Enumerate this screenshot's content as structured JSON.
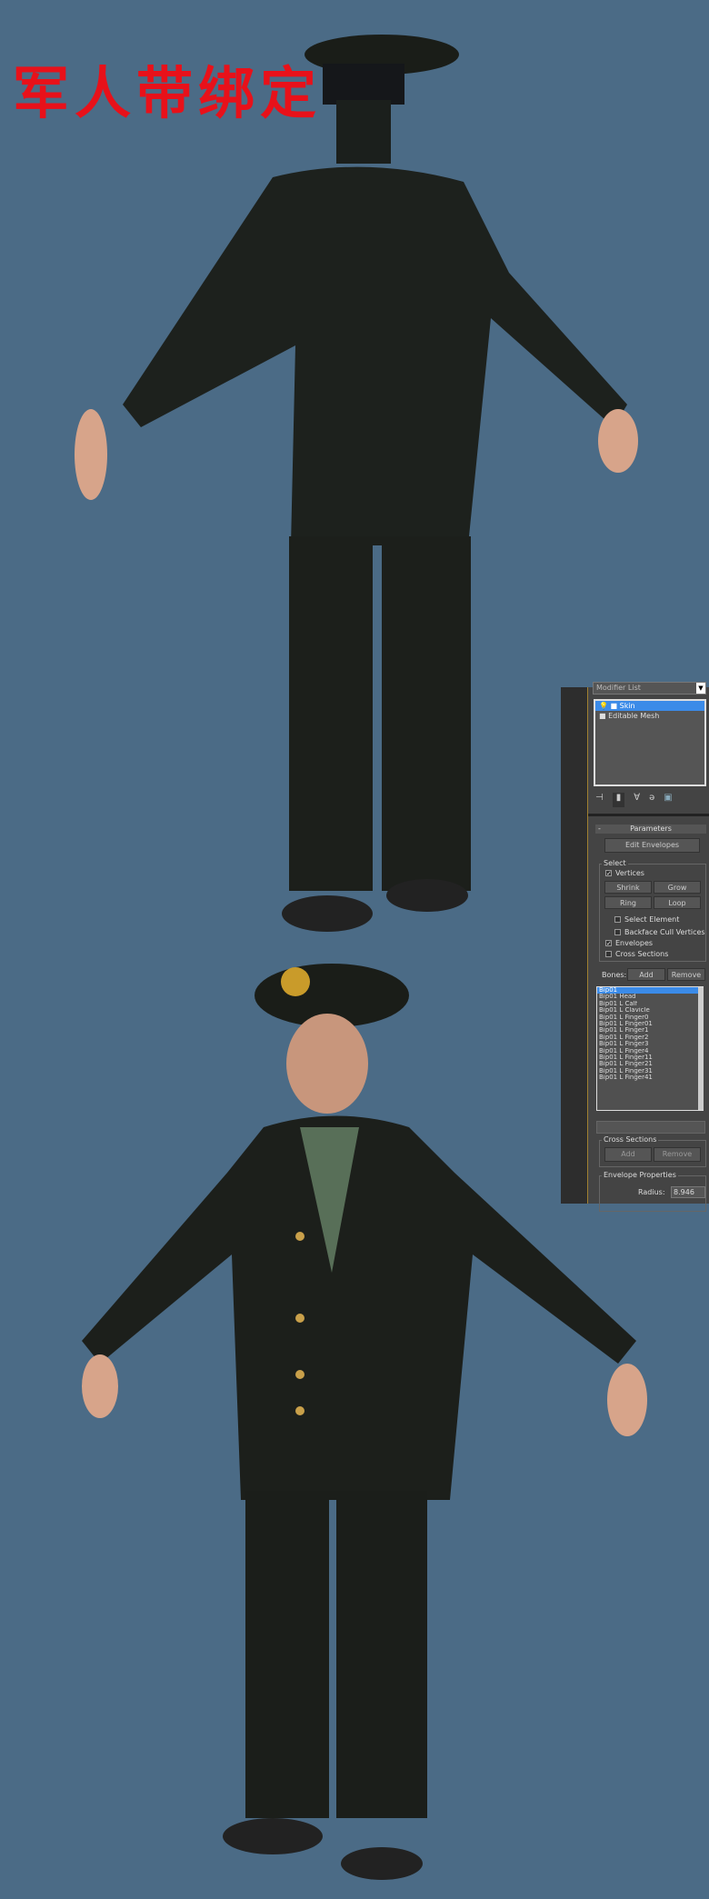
{
  "title": "军人带绑定",
  "panel": {
    "modifier_list": "Modifier List",
    "stack": [
      {
        "label": "Skin",
        "selected": true
      },
      {
        "label": "Editable Mesh",
        "selected": false
      }
    ],
    "toolbar_icons": [
      "pin-stack-icon",
      "show-end-result-icon",
      "make-unique-icon",
      "remove-modifier-icon",
      "configure-modifier-sets-icon"
    ],
    "rollout": "Parameters",
    "edit_envelopes": "Edit Envelopes",
    "select_group": "Select",
    "vertices": "Vertices",
    "shrink": "Shrink",
    "grow": "Grow",
    "ring": "Ring",
    "loop": "Loop",
    "select_element": "Select Element",
    "backface": "Backface Cull Vertices",
    "envelopes": "Envelopes",
    "cross_sections_cb": "Cross Sections",
    "bones_label": "Bones:",
    "add": "Add",
    "remove": "Remove",
    "bones": [
      "Bip01",
      "Bip01 Head",
      "Bip01 L Calf",
      "Bip01 L Clavicle",
      "Bip01 L Finger0",
      "Bip01 L Finger01",
      "Bip01 L Finger1",
      "Bip01 L Finger2",
      "Bip01 L Finger3",
      "Bip01 L Finger4",
      "Bip01 L Finger11",
      "Bip01 L Finger21",
      "Bip01 L Finger31",
      "Bip01 L Finger41"
    ],
    "cross_sections": "Cross Sections",
    "envelope_props": "Envelope Properties",
    "radius_label": "Radius:",
    "radius": "8.946",
    "checks": {
      "vertices": true,
      "select_element": false,
      "backface": false,
      "envelopes": true,
      "cross_sections": false
    }
  }
}
